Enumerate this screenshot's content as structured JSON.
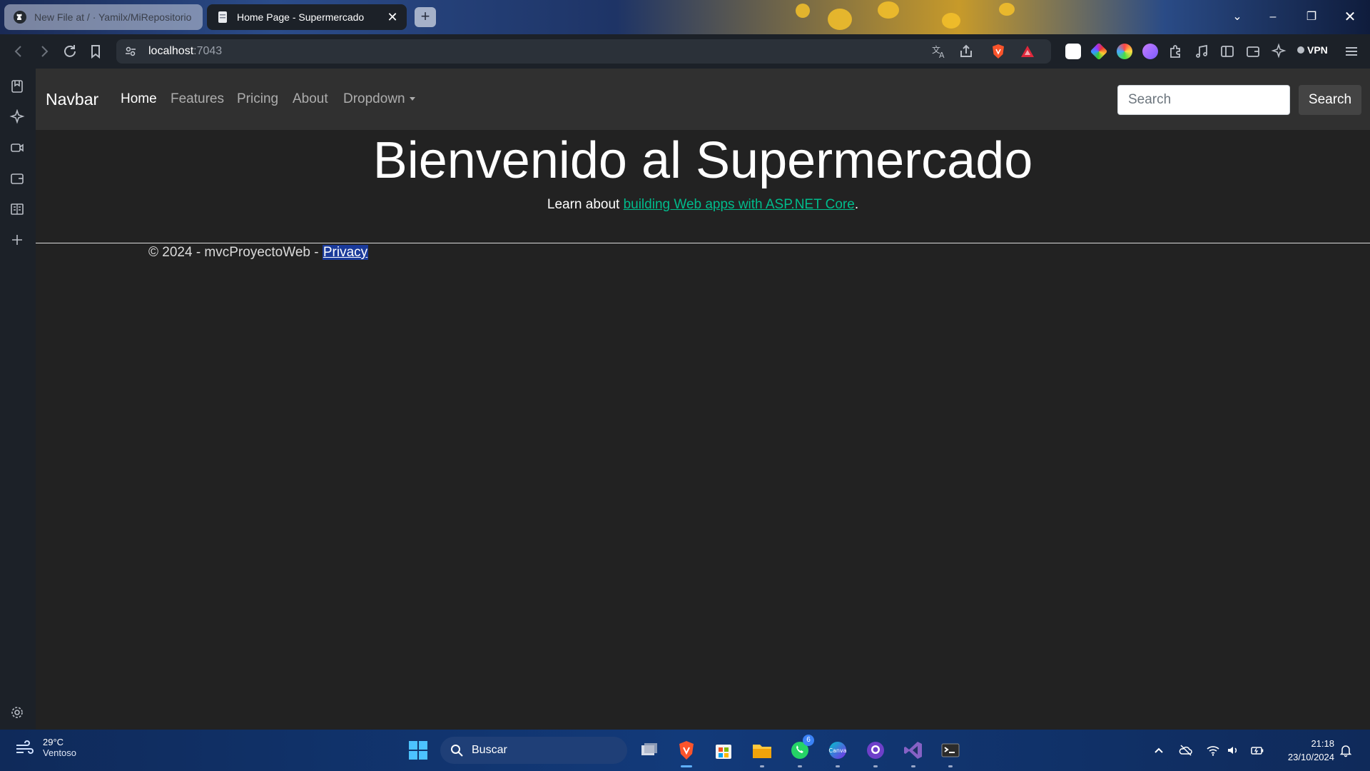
{
  "browser": {
    "tabs": [
      {
        "title": "New File at / · Yamilx/MiRepositorio",
        "active": false,
        "favicon": "github-icon"
      },
      {
        "title": "Home Page - Supermercado",
        "active": true,
        "favicon": "page-icon"
      }
    ],
    "new_tab_label": "+",
    "address": {
      "host": "localhost",
      "port": ":7043"
    },
    "vpn_label": "VPN"
  },
  "page": {
    "navbar": {
      "brand": "Navbar",
      "links": [
        "Home",
        "Features",
        "Pricing",
        "About",
        "Dropdown"
      ],
      "search_placeholder": "Search",
      "search_button": "Search"
    },
    "hero": {
      "title": "Bienvenido al Supermercado",
      "learn_prefix": "Learn about ",
      "learn_link": "building Web apps with ASP.NET Core",
      "learn_suffix": "."
    },
    "footer": {
      "text": "© 2024 - mvcProyectoWeb - ",
      "privacy": "Privacy"
    }
  },
  "taskbar": {
    "weather": {
      "temp": "29°C",
      "condition": "Ventoso"
    },
    "search_label": "Buscar",
    "whatsapp_badge": "6",
    "time": "21:18",
    "date": "23/10/2024"
  },
  "colors": {
    "accent_link": "#00bc8c",
    "navbar_bg": "#303030",
    "page_bg": "#222222"
  }
}
